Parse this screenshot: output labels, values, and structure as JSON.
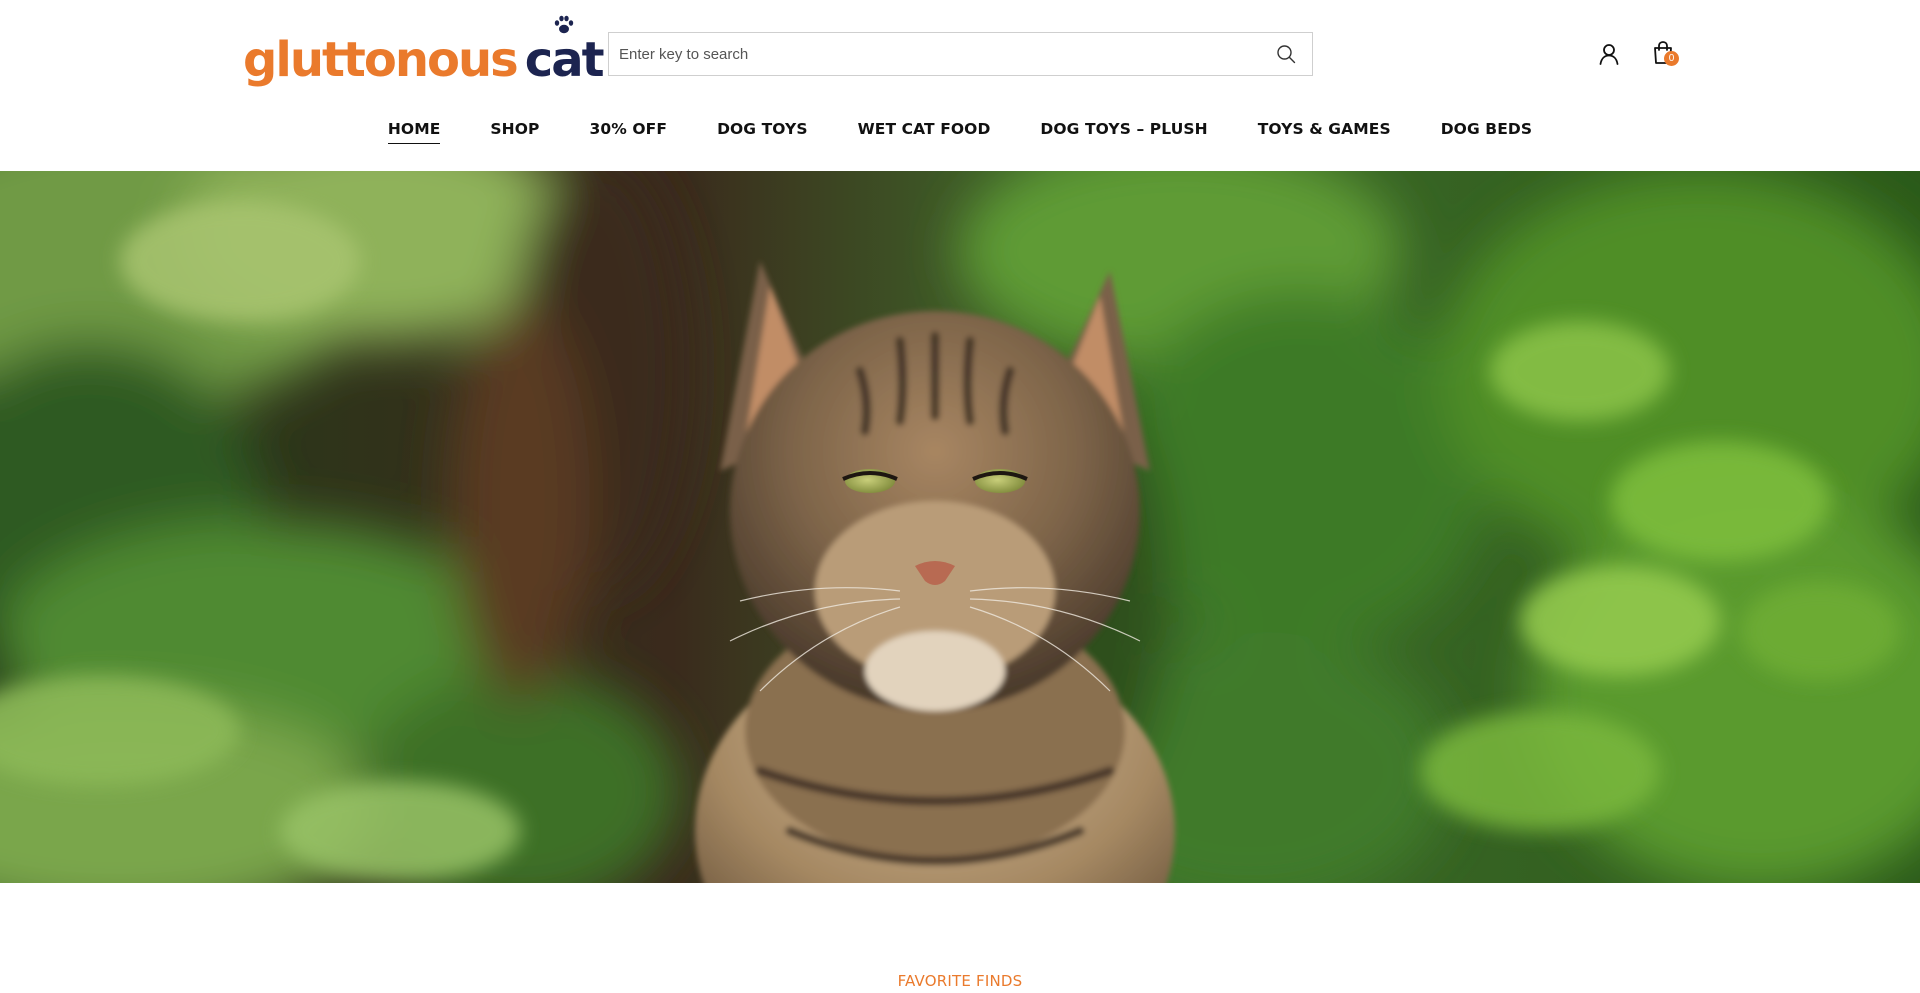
{
  "brand": {
    "name_part_1": "gluttonous",
    "name_part_2": "cat",
    "primary_color": "#ea7a2c",
    "secondary_color": "#1c2450",
    "logo_icon": "paw-icon"
  },
  "search": {
    "placeholder": "Enter key to search",
    "value": "",
    "icon": "search-icon"
  },
  "header_actions": {
    "account_icon": "user-icon",
    "cart_icon": "shopping-bag-icon",
    "cart_count": "0"
  },
  "nav": {
    "items": [
      {
        "label": "HOME",
        "active": true
      },
      {
        "label": "SHOP",
        "active": false
      },
      {
        "label": "30% OFF",
        "active": false
      },
      {
        "label": "DOG TOYS",
        "active": false
      },
      {
        "label": "WET CAT FOOD",
        "active": false
      },
      {
        "label": "DOG TOYS – PLUSH",
        "active": false
      },
      {
        "label": "TOYS & GAMES",
        "active": false
      },
      {
        "label": "DOG BEDS",
        "active": false
      }
    ]
  },
  "hero": {
    "image": "tabby-cat-in-foliage-photo"
  },
  "sections": {
    "favorite_finds_label": "FAVORITE FINDS"
  }
}
